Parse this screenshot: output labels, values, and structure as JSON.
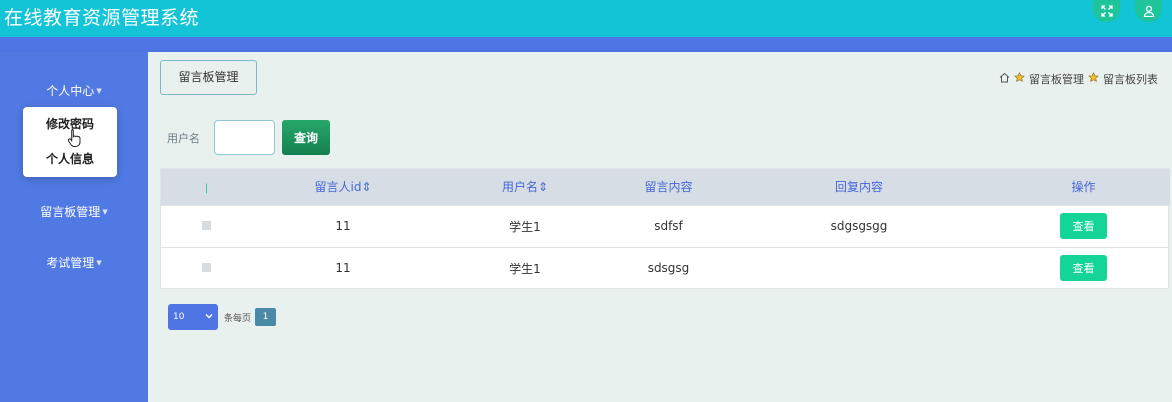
{
  "app": {
    "title": "在线教育资源管理系统"
  },
  "icons": {
    "fullscreen": "expand-icon",
    "user": "user-icon",
    "home": "home-icon",
    "star": "star-icon",
    "caret": "caret-down-icon"
  },
  "colors": {
    "header": "#13c4d6",
    "sidebar": "#5079e3",
    "primary_button": "#14d596",
    "search_button": "#1a8f5b"
  },
  "sidebar": {
    "items": [
      {
        "label": "个人中心"
      },
      {
        "label": "留言板管理"
      },
      {
        "label": "考试管理"
      }
    ],
    "dropdown": [
      "修改密码",
      "个人信息"
    ]
  },
  "page_tab": "留言板管理",
  "breadcrumb": {
    "level1": "留言板管理",
    "level2": "留言板列表"
  },
  "search": {
    "label": "用户名",
    "value": "",
    "button": "查询"
  },
  "table": {
    "headers": [
      "留言人id",
      "用户名",
      "留言内容",
      "回复内容",
      "操作"
    ],
    "sort_glyph": "⇕",
    "rows": [
      {
        "id": "11",
        "username": "学生1",
        "content": "sdfsf",
        "reply": "sdgsgsgg",
        "action": "查看"
      },
      {
        "id": "11",
        "username": "学生1",
        "content": "sdsgsg",
        "reply": "",
        "action": "查看"
      }
    ]
  },
  "pagination": {
    "page_size": "10",
    "per_page_label": "条每页",
    "current_page": "1"
  }
}
